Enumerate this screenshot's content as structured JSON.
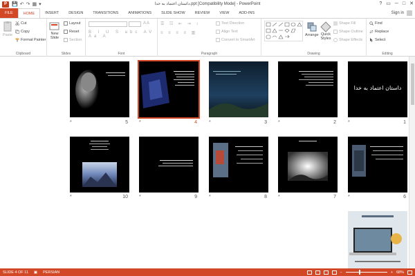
{
  "window": {
    "title": "داستان اعتماد به خدا.ppt [Compatibility Mode] - PowerPoint",
    "app_letter": "P",
    "controls": [
      "?",
      "▭",
      "─",
      "□",
      "✕"
    ]
  },
  "qat": [
    "💾",
    "↶",
    "↷",
    "▦",
    "▾"
  ],
  "tabs": {
    "file": "FILE",
    "items": [
      "HOME",
      "INSERT",
      "DESIGN",
      "TRANSITIONS",
      "ANIMATIONS",
      "SLIDE SHOW",
      "REVIEW",
      "VIEW",
      "ADD-INS"
    ],
    "active": "HOME",
    "signin": "Sign in"
  },
  "ribbon": {
    "clipboard": {
      "label": "Clipboard",
      "paste": "Paste",
      "cut": "Cut",
      "copy": "Copy",
      "format_painter": "Format Painter"
    },
    "slides": {
      "label": "Slides",
      "new_slide": "New",
      "new_slide2": "Slide",
      "layout": "Layout",
      "reset": "Reset",
      "section": "Section"
    },
    "font": {
      "label": "Font"
    },
    "paragraph": {
      "label": "Paragraph",
      "text_direction": "Text Direction",
      "align_text": "Align Text",
      "convert_smartart": "Convert to SmartArt"
    },
    "drawing": {
      "label": "Drawing",
      "arrange": "Arrange",
      "quick_styles": "Quick",
      "quick_styles2": "Styles",
      "shape_fill": "Shape Fill",
      "shape_outline": "Shape Outline",
      "shape_effects": "Shape Effects"
    },
    "editing": {
      "label": "Editing",
      "find": "Find",
      "replace": "Replace",
      "select": "Select"
    }
  },
  "slides": [
    {
      "num": "1",
      "star": "*",
      "title": "داستان اعتماد به خدا"
    },
    {
      "num": "2",
      "star": "*"
    },
    {
      "num": "3",
      "star": "*"
    },
    {
      "num": "4",
      "star": "*"
    },
    {
      "num": "5",
      "star": "*"
    },
    {
      "num": "6",
      "star": "*"
    },
    {
      "num": "7",
      "star": "*"
    },
    {
      "num": "8",
      "star": "*"
    },
    {
      "num": "9",
      "star": "*"
    },
    {
      "num": "10",
      "star": "*"
    }
  ],
  "selected_slide": "4",
  "status": {
    "slide_info": "SLIDE 4 OF 11",
    "language": "PERSIAN",
    "zoom": "68%",
    "zoom_fraction": 0.68
  },
  "colors": {
    "accent": "#d24726"
  }
}
